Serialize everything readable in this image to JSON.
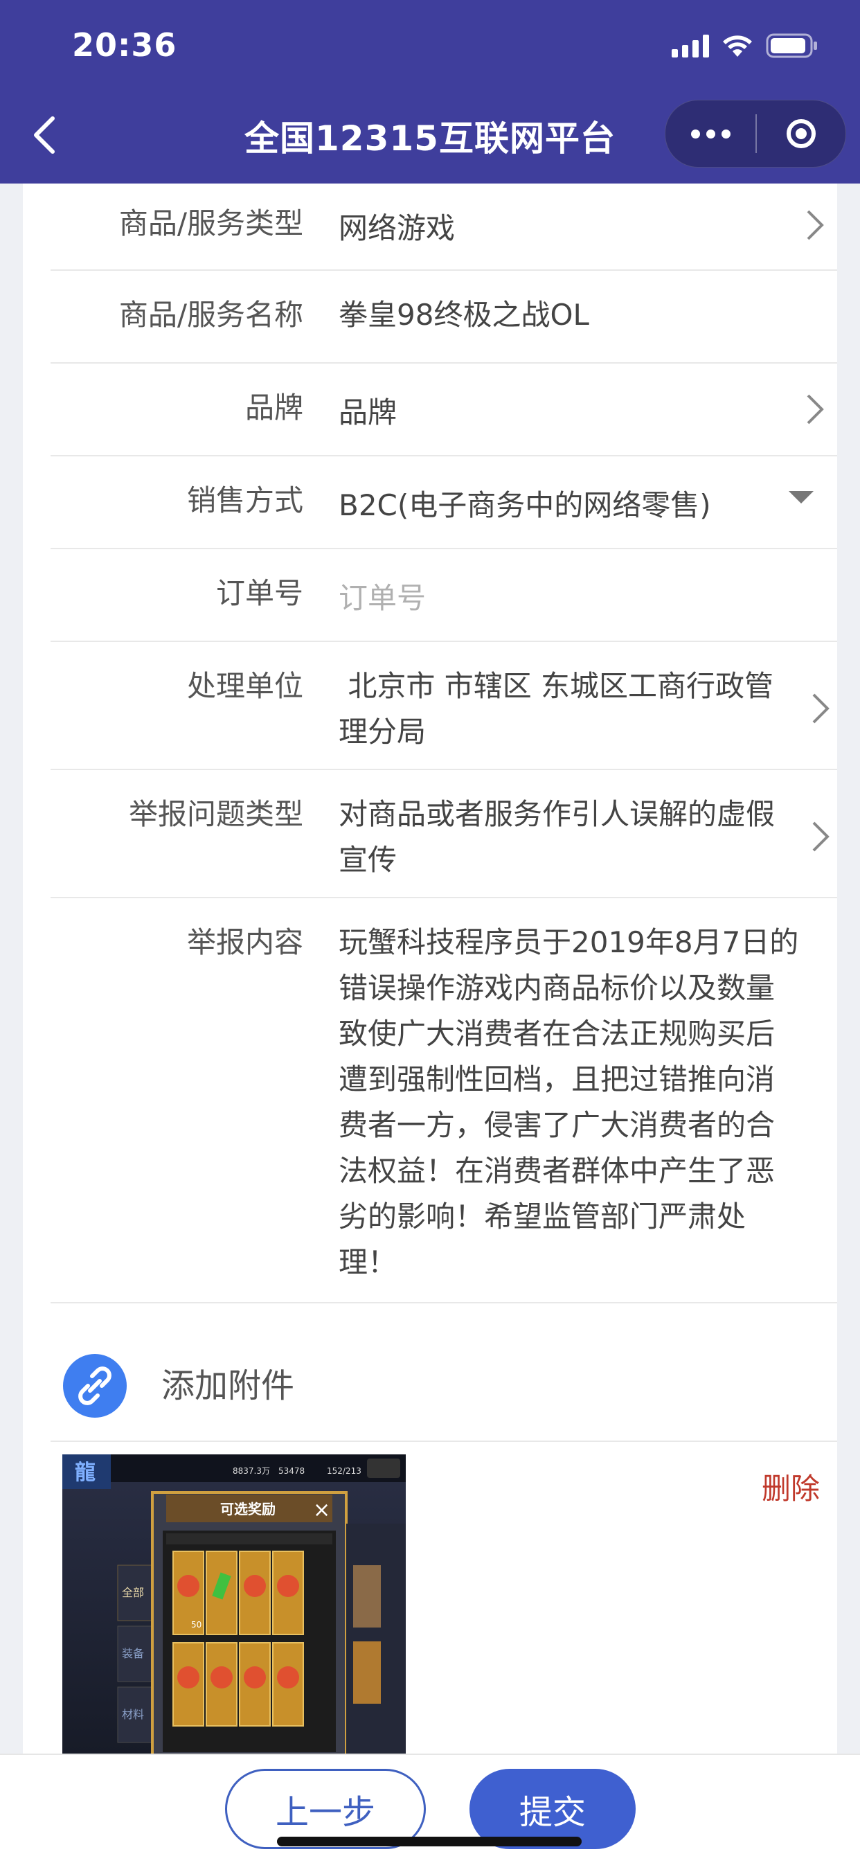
{
  "status_bar": {
    "time": "20:36"
  },
  "nav": {
    "title": "全国12315互联网平台"
  },
  "form": {
    "rows": [
      {
        "label": "商品/服务类型",
        "value": "网络游戏"
      },
      {
        "label": "商品/服务名称",
        "value": "拳皇98终极之战OL"
      },
      {
        "label": "品牌",
        "value": "品牌"
      },
      {
        "label": "销售方式",
        "value": "B2C(电子商务中的网络零售)"
      },
      {
        "label": "订单号",
        "placeholder": "订单号"
      },
      {
        "label": "处理单位",
        "value_line1": " 北京市 市辖区 东城区工商行政管",
        "value_line2": "理分局"
      },
      {
        "label": "举报问题类型",
        "value_line1": "对商品或者服务作引人误解的虚假",
        "value_line2": "宣传"
      },
      {
        "label": "举报内容",
        "lines": [
          "玩蟹科技程序员于2019年8月7日的",
          "错误操作游戏内商品标价以及数量",
          "致使广大消费者在合法正规购买后",
          "遭到强制性回档，且把过错推向消",
          "费者一方，侵害了广大消费者的合",
          "法权益！在消费者群体中产生了恶",
          "劣的影响！希望监管部门严肃处",
          "理！"
        ]
      }
    ]
  },
  "attachments": {
    "add_label": "添加附件",
    "delete_label": "删除",
    "thumbnail": {
      "panel_title": "可选奖励",
      "resources": [
        "8837.3万",
        "53478",
        "152/213"
      ],
      "side_tabs": [
        "全部",
        "装备",
        "材料"
      ],
      "card_value": "50"
    }
  },
  "actions": {
    "prev_label": "上一步",
    "submit_label": "提交"
  },
  "colors": {
    "header": "#3f3e9c",
    "primary": "#3f60d0",
    "danger": "#c0392b",
    "attach_icon": "#3f7ef0"
  }
}
